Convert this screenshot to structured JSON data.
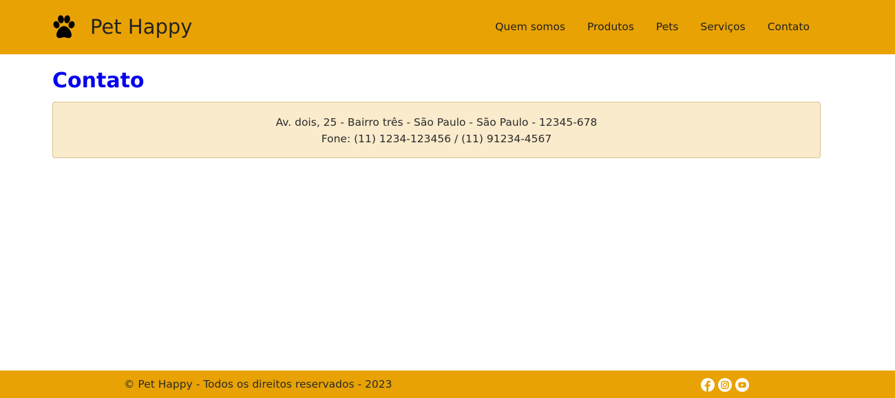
{
  "header": {
    "brand_name": "Pet Happy",
    "brand_icon": "paw-icon",
    "nav": [
      {
        "label": "Quem somos"
      },
      {
        "label": "Produtos"
      },
      {
        "label": "Pets"
      },
      {
        "label": "Serviços"
      },
      {
        "label": "Contato"
      }
    ]
  },
  "main": {
    "title": "Contato",
    "address": "Av. dois, 25 - Bairro três - São Paulo - São Paulo - 12345-678",
    "phone": "Fone: (11) 1234-123456 / (11) 91234-4567"
  },
  "footer": {
    "copyright": "© Pet Happy - Todos os direitos reservados - 2023",
    "social": [
      "facebook-icon",
      "instagram-icon",
      "youtube-icon"
    ]
  },
  "colors": {
    "header_bg": "#e8a203",
    "title": "#0000ee",
    "card_bg": "#faebcc"
  }
}
